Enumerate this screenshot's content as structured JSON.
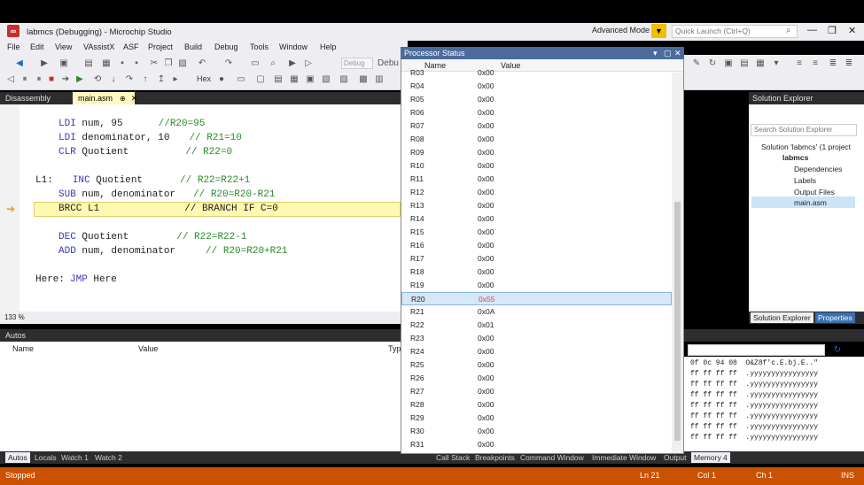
{
  "window": {
    "title": "labmcs (Debugging) - Microchip Studio",
    "advanced_mode": "Advanced Mode",
    "quick_launch_placeholder": "Quick Launch (Ctrl+Q)"
  },
  "menu": [
    "File",
    "Edit",
    "View",
    "VAssistX",
    "ASF",
    "Project",
    "Build",
    "Debug",
    "Tools",
    "Window",
    "Help"
  ],
  "toolbar": {
    "config": "Debug",
    "hex_label": "Hex",
    "debug_label": "Debu"
  },
  "tabs": {
    "disassembly": "Disassembly",
    "main": "main.asm"
  },
  "code": {
    "l1_kw": "LDI",
    "l1_rest": " num, 95",
    "l1_comment": "//R20=95",
    "l2_kw": "LDI",
    "l2_rest": " denominator, 10",
    "l2_comment": "// R21=10",
    "l3_kw": "CLR",
    "l3_rest": " Quotient",
    "l3_comment": "// R22=0",
    "l4_label": "L1:",
    "l4_kw": "INC",
    "l4_rest": " Quotient",
    "l4_comment": "// R22=R22+1",
    "l5_kw": "SUB",
    "l5_rest": " num, denominator",
    "l5_comment": "// R20=R20-R21",
    "l6_kw": "BRCC",
    "l6_rest": " L1",
    "l6_comment": "// BRANCH IF C=0",
    "l7_kw": "DEC",
    "l7_rest": " Quotient",
    "l7_comment": "// R22=R22-1",
    "l8_kw": "ADD",
    "l8_rest": " num, denominator",
    "l8_comment": "// R20=R20+R21",
    "l9_label": "Here:",
    "l9_kw": "JMP",
    "l9_rest": " Here"
  },
  "zoom": "133 %",
  "autos": {
    "title": "Autos",
    "col_name": "Name",
    "col_value": "Value",
    "col_type": "Typ",
    "tabs": [
      "Autos",
      "Locals",
      "Watch 1",
      "Watch 2"
    ]
  },
  "processor_status": {
    "title": "Processor Status",
    "col_name": "Name",
    "col_value": "Value",
    "rows": [
      {
        "name": "R03",
        "value": "0x00"
      },
      {
        "name": "R04",
        "value": "0x00"
      },
      {
        "name": "R05",
        "value": "0x00"
      },
      {
        "name": "R06",
        "value": "0x00"
      },
      {
        "name": "R07",
        "value": "0x00"
      },
      {
        "name": "R08",
        "value": "0x00"
      },
      {
        "name": "R09",
        "value": "0x00"
      },
      {
        "name": "R10",
        "value": "0x00"
      },
      {
        "name": "R11",
        "value": "0x00"
      },
      {
        "name": "R12",
        "value": "0x00"
      },
      {
        "name": "R13",
        "value": "0x00"
      },
      {
        "name": "R14",
        "value": "0x00"
      },
      {
        "name": "R15",
        "value": "0x00"
      },
      {
        "name": "R16",
        "value": "0x00"
      },
      {
        "name": "R17",
        "value": "0x00"
      },
      {
        "name": "R18",
        "value": "0x00"
      },
      {
        "name": "R19",
        "value": "0x00"
      },
      {
        "name": "R20",
        "value": "0x55"
      },
      {
        "name": "R21",
        "value": "0x0A"
      },
      {
        "name": "R22",
        "value": "0x01"
      },
      {
        "name": "R23",
        "value": "0x00"
      },
      {
        "name": "R24",
        "value": "0x00"
      },
      {
        "name": "R25",
        "value": "0x00"
      },
      {
        "name": "R26",
        "value": "0x00"
      },
      {
        "name": "R27",
        "value": "0x00"
      },
      {
        "name": "R28",
        "value": "0x00"
      },
      {
        "name": "R29",
        "value": "0x00"
      },
      {
        "name": "R30",
        "value": "0x00"
      },
      {
        "name": "R31",
        "value": "0x00"
      }
    ],
    "selected": "R20"
  },
  "solution_explorer": {
    "title": "Solution Explorer",
    "search_placeholder": "Search Solution Explorer",
    "solution": "Solution 'labmcs' (1 project",
    "project": "labmcs",
    "items": [
      "Dependencies",
      "Labels",
      "Output Files",
      "main.asm"
    ],
    "tab_se": "Solution Explorer",
    "tab_props": "Properties"
  },
  "memory": {
    "lines": [
      "0f 0c 94 08  O&Z8f'c.E.bj.E..\"",
      "ff ff ff ff  .yyyyyyyyyyyyyyyy",
      "ff ff ff ff  .yyyyyyyyyyyyyyyy",
      "ff ff ff ff  .yyyyyyyyyyyyyyyy",
      "ff ff ff ff  .yyyyyyyyyyyyyyyy",
      "ff ff ff ff  .yyyyyyyyyyyyyyyy",
      "ff ff ff ff  .yyyyyyyyyyyyyyyy",
      "ff ff ff ff  .yyyyyyyyyyyyyyyy"
    ]
  },
  "bottom_tabs": [
    "Call Stack",
    "Breakpoints",
    "Command Window",
    "Immediate Window",
    "Output",
    "Memory 4"
  ],
  "status": {
    "state": "Stopped",
    "ln": "Ln 21",
    "col": "Col 1",
    "ch": "Ch 1",
    "ins": "INS"
  }
}
